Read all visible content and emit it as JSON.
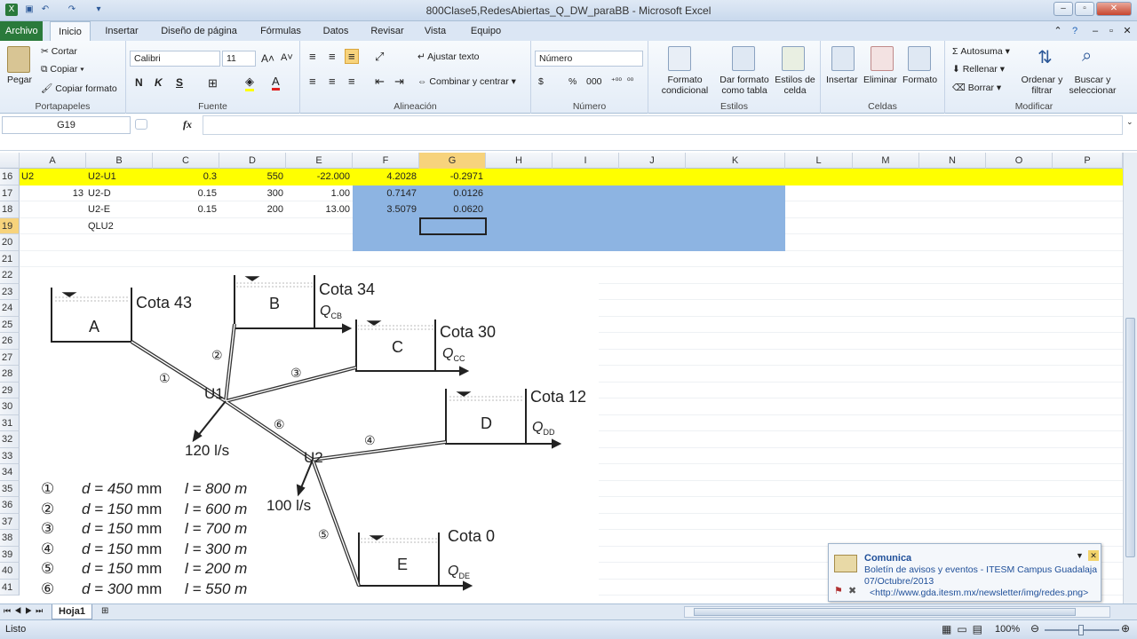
{
  "window": {
    "title": "800Clase5,RedesAbiertas_Q_DW_paraBB - Microsoft Excel"
  },
  "tabs": [
    "Archivo",
    "Inicio",
    "Insertar",
    "Diseño de página",
    "Fórmulas",
    "Datos",
    "Revisar",
    "Vista",
    "Equipo"
  ],
  "ribbon": {
    "clipboard": {
      "paste": "Pegar",
      "cut": "Cortar",
      "copy": "Copiar",
      "format_painter": "Copiar formato",
      "label": "Portapapeles"
    },
    "font": {
      "name": "Calibri",
      "size": "11",
      "label": "Fuente",
      "bold": "N",
      "italic": "K",
      "underline": "S"
    },
    "alignment": {
      "wrap": "Ajustar texto",
      "merge": "Combinar y centrar",
      "label": "Alineación"
    },
    "number": {
      "format": "Número",
      "label": "Número",
      "percent": "%",
      "thousands": "000",
      "currency": "$"
    },
    "styles": {
      "cond": "Formato condicional",
      "table": "Dar formato como tabla",
      "cell": "Estilos de celda",
      "label": "Estilos"
    },
    "cells": {
      "insert": "Insertar",
      "delete": "Eliminar",
      "format": "Formato",
      "label": "Celdas"
    },
    "editing": {
      "autosum": "Autosuma",
      "fill": "Rellenar",
      "clear": "Borrar",
      "sort": "Ordenar y filtrar",
      "find": "Buscar y seleccionar",
      "label": "Modificar"
    }
  },
  "formula_bar": {
    "name_box": "G19",
    "fx": "fx",
    "formula": ""
  },
  "columns": [
    "A",
    "B",
    "C",
    "D",
    "E",
    "F",
    "G",
    "H",
    "I",
    "J",
    "K",
    "L",
    "M",
    "N",
    "O",
    "P"
  ],
  "rows": [
    "16",
    "17",
    "18",
    "19",
    "20",
    "21",
    "22",
    "23",
    "24",
    "25",
    "26",
    "27",
    "28",
    "29",
    "30",
    "31",
    "32",
    "33",
    "34",
    "35",
    "36",
    "37",
    "38",
    "39",
    "40",
    "41"
  ],
  "cells": {
    "r16": {
      "a": "U2",
      "b": "U2-U1",
      "c": "0.3",
      "d": "550",
      "e": "-22.000",
      "f": "4.2028",
      "g": "-0.2971"
    },
    "r17": {
      "a": "13",
      "b": "U2-D",
      "c": "0.15",
      "d": "300",
      "e": "1.00",
      "f": "0.7147",
      "g": "0.0126"
    },
    "r18": {
      "b": "U2-E",
      "c": "0.15",
      "d": "200",
      "e": "13.00",
      "f": "3.5079",
      "g": "0.0620"
    },
    "r19": {
      "b": "QLU2"
    }
  },
  "diagram": {
    "tanks": [
      {
        "name": "A",
        "cota": "Cota 43"
      },
      {
        "name": "B",
        "cota": "Cota 34",
        "q": "Q",
        "qsub": "CB"
      },
      {
        "name": "C",
        "cota": "Cota 30",
        "q": "Q",
        "qsub": "CC"
      },
      {
        "name": "D",
        "cota": "Cota 12",
        "q": "Q",
        "qsub": "DD"
      },
      {
        "name": "E",
        "cota": "Cota 0",
        "q": "Q",
        "qsub": "DE"
      }
    ],
    "nodes": [
      "U1",
      "U2"
    ],
    "flows": [
      "120 l/s",
      "100 l/s"
    ],
    "pipe_labels": [
      "①",
      "②",
      "③",
      "④",
      "⑤",
      "⑥"
    ],
    "pipes": [
      {
        "n": "①",
        "d": "d = 450",
        "du": "mm",
        "l": "l = 800 m"
      },
      {
        "n": "②",
        "d": "d = 150",
        "du": "mm",
        "l": "l = 600 m"
      },
      {
        "n": "③",
        "d": "d = 150",
        "du": "mm",
        "l": "l = 700 m"
      },
      {
        "n": "④",
        "d": "d = 150",
        "du": "mm",
        "l": "l = 300 m"
      },
      {
        "n": "⑤",
        "d": "d = 150",
        "du": "mm",
        "l": "l = 200 m"
      },
      {
        "n": "⑥",
        "d": "d = 300",
        "du": "mm",
        "l": "l = 550 m"
      }
    ]
  },
  "sheet_tab": "Hoja1",
  "status": {
    "ready": "Listo",
    "zoom": "100%"
  },
  "notification": {
    "title": "Comunica",
    "line1": "Boletín de avisos y eventos - ITESM Campus Guadalajara",
    "line2": "07/Octubre/2013",
    "line3": "<http://www.gda.itesm.mx/newsletter/img/redes.png>"
  },
  "colors": {
    "highlight_row": "#ffff00",
    "selection": "#8db4e2",
    "file_tab": "#2a7a3b"
  }
}
